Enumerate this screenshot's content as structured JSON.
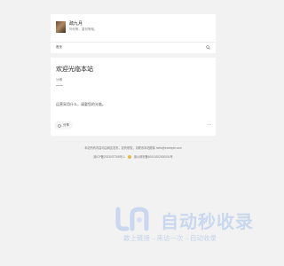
{
  "profile": {
    "name": "疏九月",
    "bio": "你何等，重何等哉。",
    "home_label": "首页",
    "search_icon": "search-icon"
  },
  "post": {
    "title": "欢迎光临本站",
    "author": "沙博",
    "body": "运营采用什么，请要您的光临。",
    "share_label": "分享",
    "more_label": "···"
  },
  "footer": {
    "line1": "本站所有内容均由网友发布，如有侵权，请联系本站删除 hello@example.com",
    "icp": "渝ICP备2023007766号-1",
    "police": "渝公网安备50010202000001号"
  },
  "watermark": {
    "title": "自动秒收录",
    "subtitle": "敢上链接→来访一次→自动收录"
  },
  "colors": {
    "background": "#f2f2f2",
    "card": "#ffffff",
    "watermark": "#c9d8ee"
  }
}
